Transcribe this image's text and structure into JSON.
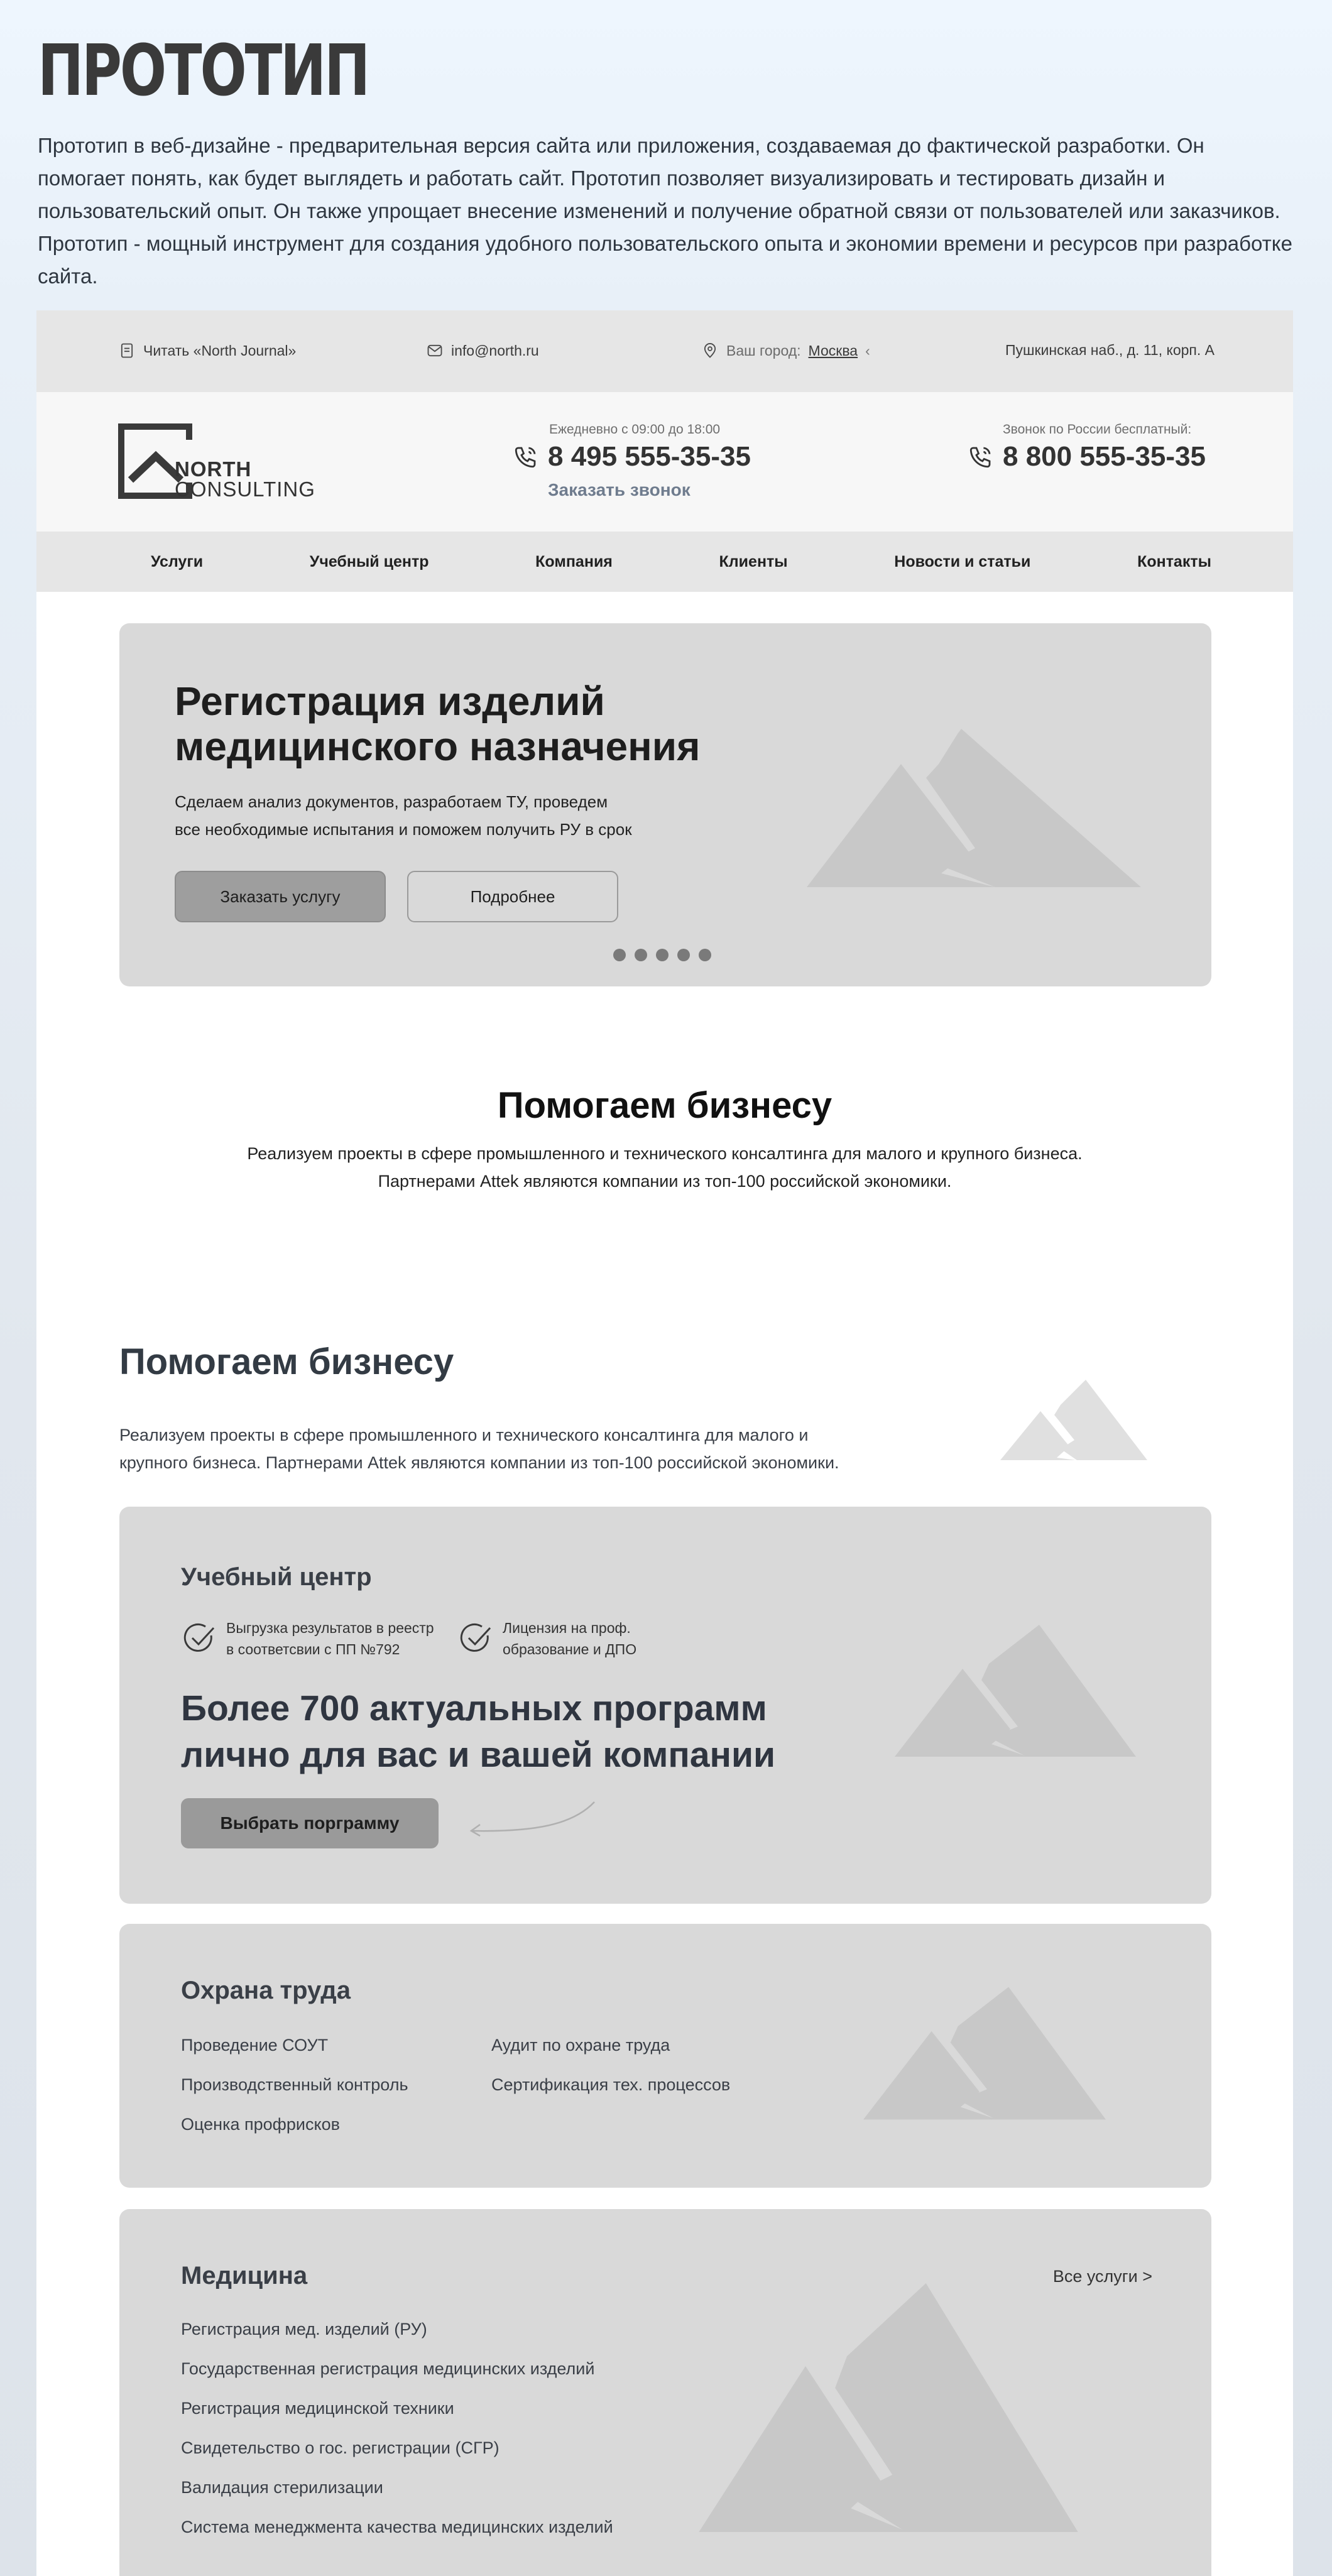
{
  "page": {
    "title": "ПРОТОТИП",
    "intro": "Прототип в веб-дизайне - предварительная версия сайта или приложения, создаваемая до фактической разработки. Он помогает понять, как будет выглядеть и работать сайт. Прототип позволяет визуализировать и тестировать дизайн и пользовательский опыт. Он также упрощает внесение изменений и получение обратной связи от пользователей или заказчиков. Прототип - мощный инструмент для создания удобного пользовательского опыта и экономии времени и ресурсов при разработке сайта."
  },
  "topbar": {
    "journal": "Читать «North Journal»",
    "email": "info@north.ru",
    "city_label": "Ваш город:",
    "city": "Москва",
    "address": "Пушкинская наб., д. 11, корп. А"
  },
  "header": {
    "logo_line1": "NORTH",
    "logo_line2": "CONSULTING",
    "hours": "Ежедневно с 09:00 до 18:00",
    "phone1": "8 495 555-35-35",
    "order_call": "Заказать звонок",
    "free_call_note": "Звонок по России бесплатный:",
    "phone2": "8 800 555-35-35"
  },
  "nav": [
    "Услуги",
    "Учебный центр",
    "Компания",
    "Клиенты",
    "Новости и статьи",
    "Контакты"
  ],
  "hero": {
    "title_line1": "Регистрация изделий",
    "title_line2": "медицинского  назначения",
    "text_line1": "Сделаем анализ документов, разработаем ТУ, проведем",
    "text_line2": "все необходимые испытания и поможем получить РУ в срок",
    "btn_primary": "Заказать услугу",
    "btn_secondary": "Подробнее",
    "slides": 5
  },
  "help_center": {
    "title": "Помогаем бизнесу",
    "line1": "Реализуем проекты в сфере промышленного и технического консалтинга для малого и крупного бизнеса.",
    "line2": "Партнерами Attek являются компании из топ-100 российской экономики."
  },
  "help_left": {
    "title": "Помогаем бизнесу",
    "line1": "Реализуем проекты в сфере промышленного и технического консалтинга для малого и",
    "line2": "крупного бизнеса.  Партнерами Attek являются компании из топ-100 российской экономики."
  },
  "training": {
    "title": "Учебный центр",
    "check1_line1": "Выгрузка результатов в реестр",
    "check1_line2": "в соответсвии с ПП №792",
    "check2_line1": "Лицензия на проф.",
    "check2_line2": "образование и ДПО",
    "headline1": "Более 700 актуальных программ",
    "headline2": "лично для вас и вашей компании",
    "button": "Выбрать порграмму"
  },
  "labor": {
    "title": "Охрана труда",
    "col1": [
      "Проведение СОУТ",
      "Производственный контроль",
      "Оценка профрисков"
    ],
    "col2": [
      "Аудит по охране труда",
      "Сертификация тех. процессов"
    ]
  },
  "medicine": {
    "title": "Медицина",
    "all_services": "Все услуги >",
    "items": [
      "Регистрация мед. изделий (РУ)",
      "Государственная регистрация медицинских изделий",
      "Регистрация медицинской техники",
      "Свидетельство о гос. регистрации (СГР)",
      "Валидация стерилизации",
      "Система менеджмента качества медицинских изделий"
    ]
  },
  "colors": {
    "card_bg": "#d9d9d9",
    "bar_bg": "#e6e6e6",
    "accent_link": "#6f7c8e"
  }
}
